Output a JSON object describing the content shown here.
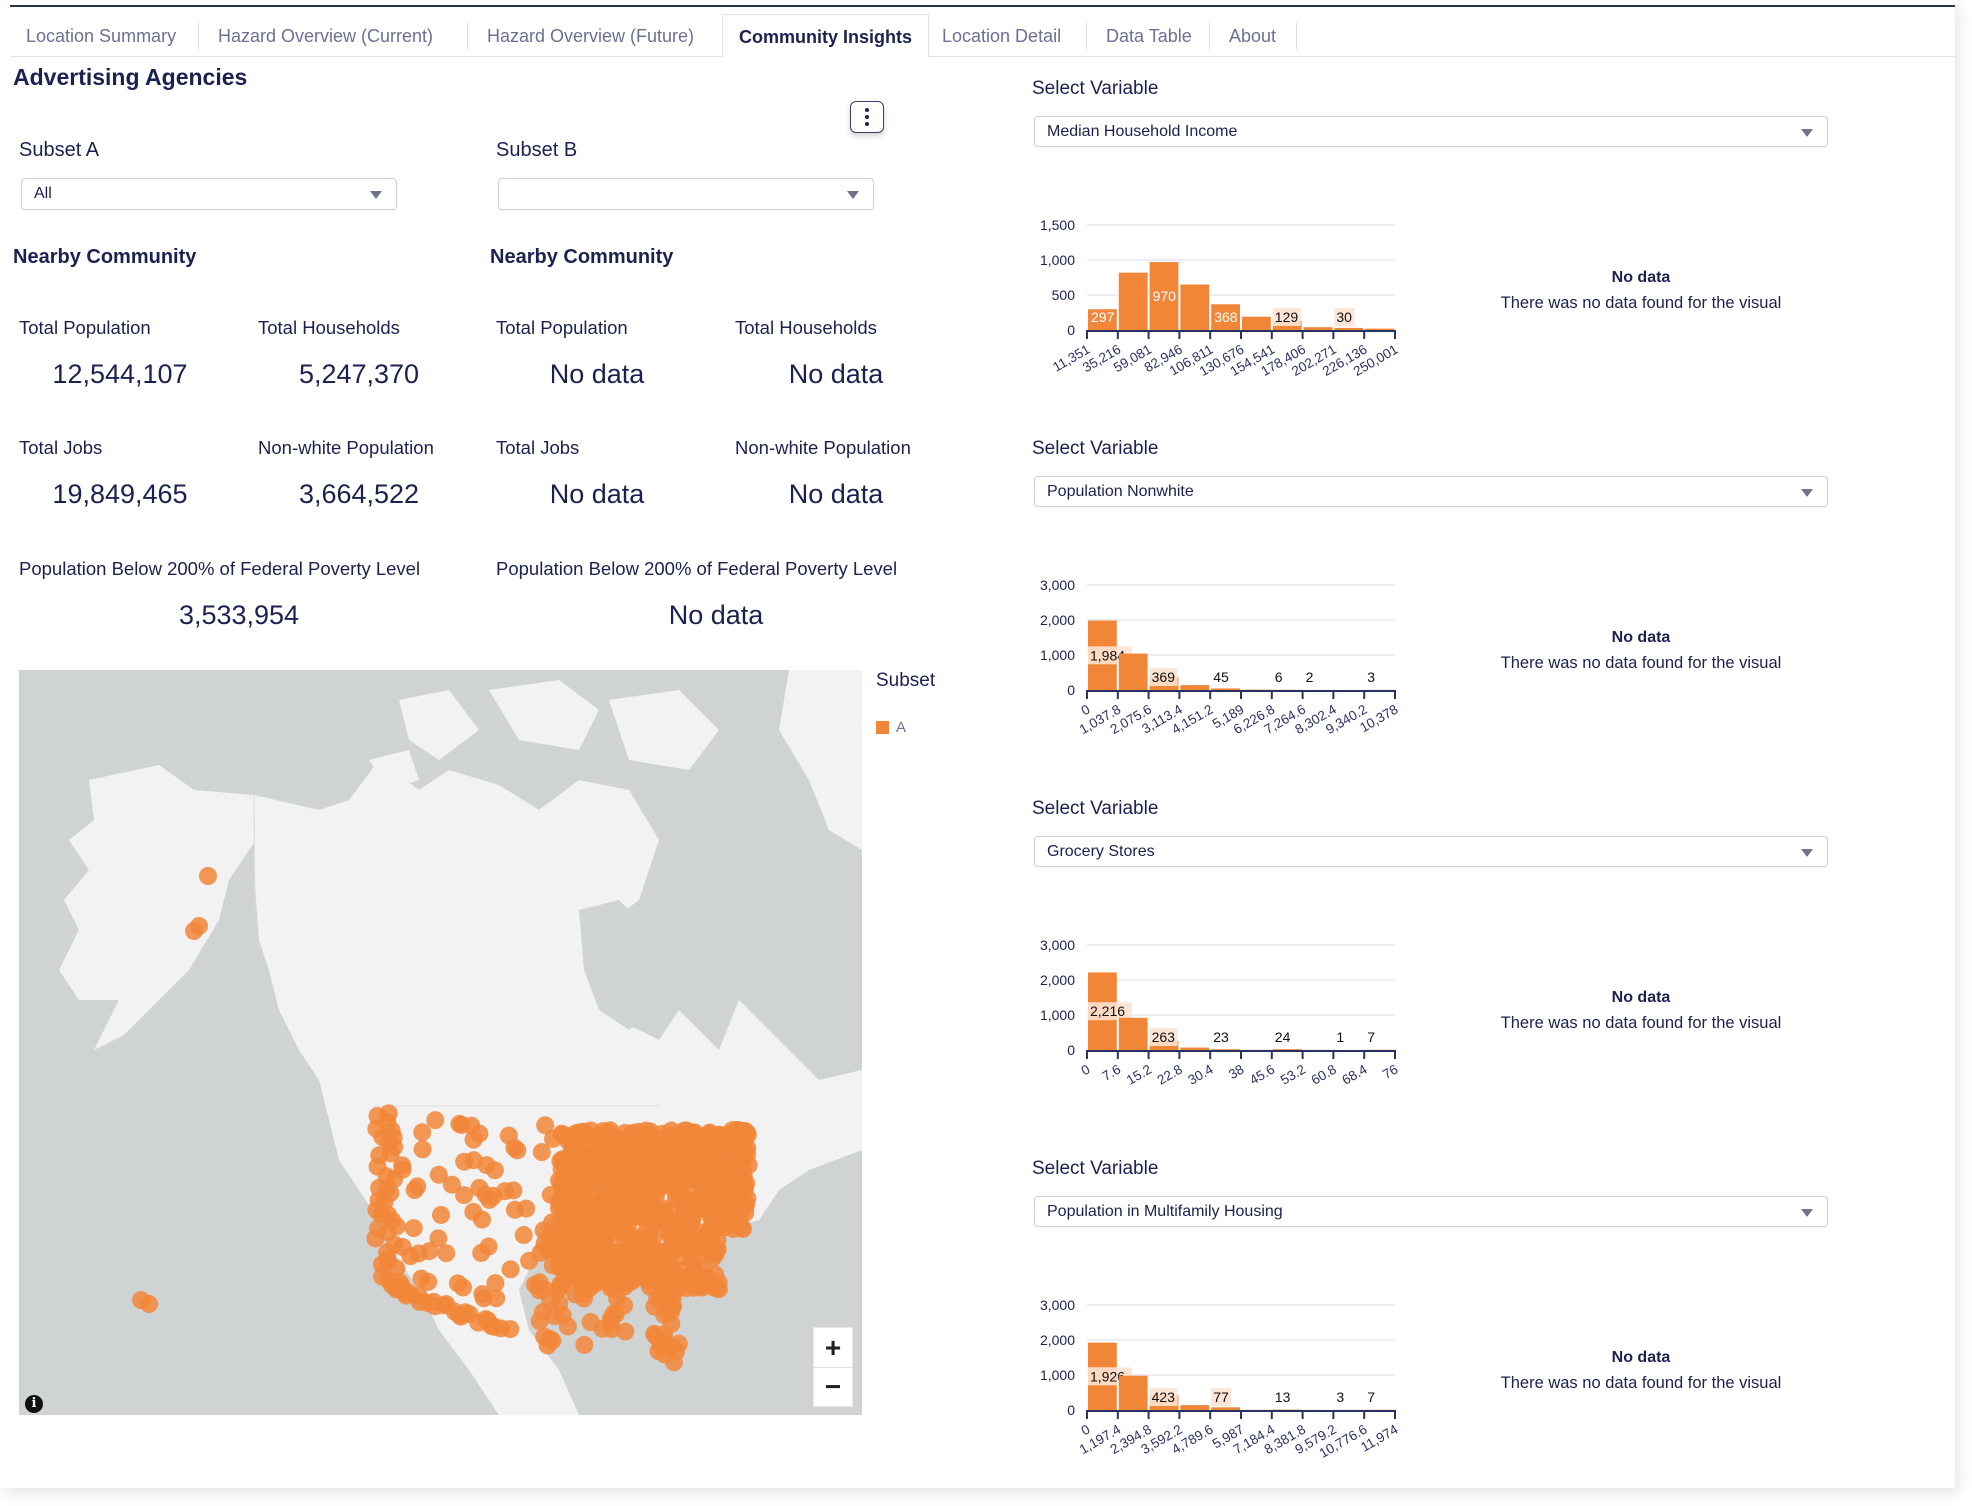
{
  "tabs": [
    {
      "label": "Location Summary",
      "active": false
    },
    {
      "label": "Hazard Overview (Current)",
      "active": false
    },
    {
      "label": "Hazard Overview (Future)",
      "active": false
    },
    {
      "label": "Community Insights",
      "active": true
    },
    {
      "label": "Location Detail",
      "active": false
    },
    {
      "label": "Data Table",
      "active": false
    },
    {
      "label": "About",
      "active": false
    }
  ],
  "page_title": "Advertising Agencies",
  "menu_icon": "kebab-menu-icon",
  "subset_a": {
    "label": "Subset A",
    "selected": "All",
    "section_title": "Nearby Community",
    "stats": {
      "total_population": {
        "label": "Total Population",
        "value": "12,544,107"
      },
      "total_households": {
        "label": "Total Households",
        "value": "5,247,370"
      },
      "total_jobs": {
        "label": "Total Jobs",
        "value": "19,849,465"
      },
      "nonwhite_population": {
        "label": "Non-white Population",
        "value": "3,664,522"
      },
      "poverty": {
        "label": "Population Below 200% of Federal Poverty Level",
        "value": "3,533,954"
      }
    }
  },
  "subset_b": {
    "label": "Subset B",
    "selected": "",
    "section_title": "Nearby Community",
    "stats": {
      "total_population": {
        "label": "Total Population",
        "value": "No data"
      },
      "total_households": {
        "label": "Total Households",
        "value": "No data"
      },
      "total_jobs": {
        "label": "Total Jobs",
        "value": "No data"
      },
      "nonwhite_population": {
        "label": "Non-white Population",
        "value": "No data"
      },
      "poverty": {
        "label": "Population Below 200% of Federal Poverty Level",
        "value": "No data"
      }
    }
  },
  "map": {
    "legend_title": "Subset",
    "legend_items": [
      {
        "label": "A",
        "color": "#f28638"
      }
    ],
    "zoom_in": "+",
    "zoom_out": "−",
    "info": "i"
  },
  "colors": {
    "accent": "#f28638",
    "accent_light": "#fde3d2",
    "text": "#1b2150",
    "map_water": "#d0d3d4",
    "map_land": "#f2f2f2"
  },
  "variable_panels": [
    {
      "label": "Select Variable",
      "selected": "Median Household Income",
      "nodata_title": "No data",
      "nodata_text": "There was no data found for the visual"
    },
    {
      "label": "Select Variable",
      "selected": "Population Nonwhite",
      "nodata_title": "No data",
      "nodata_text": "There was no data found for the visual"
    },
    {
      "label": "Select Variable",
      "selected": "Grocery Stores",
      "nodata_title": "No data",
      "nodata_text": "There was no data found for the visual"
    },
    {
      "label": "Select Variable",
      "selected": "Population in Multifamily Housing",
      "nodata_title": "No data",
      "nodata_text": "There was no data found for the visual"
    }
  ],
  "chart_data": [
    {
      "type": "bar",
      "title": "Median Household Income",
      "x_ticks": [
        "11,351",
        "35,216",
        "59,081",
        "82,946",
        "106,811",
        "130,676",
        "154,541",
        "178,406",
        "202,271",
        "226,136",
        "250,001"
      ],
      "values": [
        297,
        820,
        970,
        650,
        368,
        190,
        129,
        40,
        30,
        20
      ],
      "labels": [
        "297",
        "",
        "970",
        "",
        "368",
        "",
        "129",
        "",
        "30",
        ""
      ],
      "y_ticks": [
        "0",
        "500",
        "1,000",
        "1,500"
      ],
      "ylim": [
        0,
        1500
      ],
      "grid": true
    },
    {
      "type": "bar",
      "title": "Population Nonwhite",
      "x_ticks": [
        "0",
        "1,037.8",
        "2,075.6",
        "3,113.4",
        "4,151.2",
        "5,189",
        "6,226.8",
        "7,264.6",
        "8,302.4",
        "9,340.2",
        "10,378"
      ],
      "values": [
        1984,
        1040,
        369,
        140,
        45,
        10,
        6,
        2,
        1,
        3
      ],
      "labels": [
        "1,984",
        "",
        "369",
        "",
        "45",
        "",
        "6",
        "2",
        "",
        "3"
      ],
      "y_ticks": [
        "0",
        "1,000",
        "2,000",
        "3,000"
      ],
      "ylim": [
        0,
        3000
      ],
      "grid": true
    },
    {
      "type": "bar",
      "title": "Grocery Stores",
      "x_ticks": [
        "0",
        "7.6",
        "15.2",
        "22.8",
        "30.4",
        "38",
        "45.6",
        "53.2",
        "60.8",
        "68.4",
        "76"
      ],
      "values": [
        2216,
        920,
        263,
        70,
        23,
        5,
        24,
        3,
        1,
        7
      ],
      "labels": [
        "2,216",
        "",
        "263",
        "",
        "23",
        "",
        "24",
        "",
        "1",
        "7"
      ],
      "y_ticks": [
        "0",
        "1,000",
        "2,000",
        "3,000"
      ],
      "ylim": [
        0,
        3000
      ],
      "grid": true
    },
    {
      "type": "bar",
      "title": "Population in Multifamily Housing",
      "x_ticks": [
        "0",
        "1,197.4",
        "2,394.8",
        "3,592.2",
        "4,789.6",
        "5,987",
        "7,184.4",
        "8,381.8",
        "9,579.2",
        "10,776.6",
        "11,974"
      ],
      "values": [
        1926,
        980,
        423,
        140,
        77,
        5,
        13,
        2,
        3,
        7
      ],
      "labels": [
        "1,926",
        "",
        "423",
        "",
        "77",
        "",
        "13",
        "",
        "3",
        "7"
      ],
      "y_ticks": [
        "0",
        "1,000",
        "2,000",
        "3,000"
      ],
      "ylim": [
        0,
        3000
      ],
      "grid": true
    }
  ]
}
